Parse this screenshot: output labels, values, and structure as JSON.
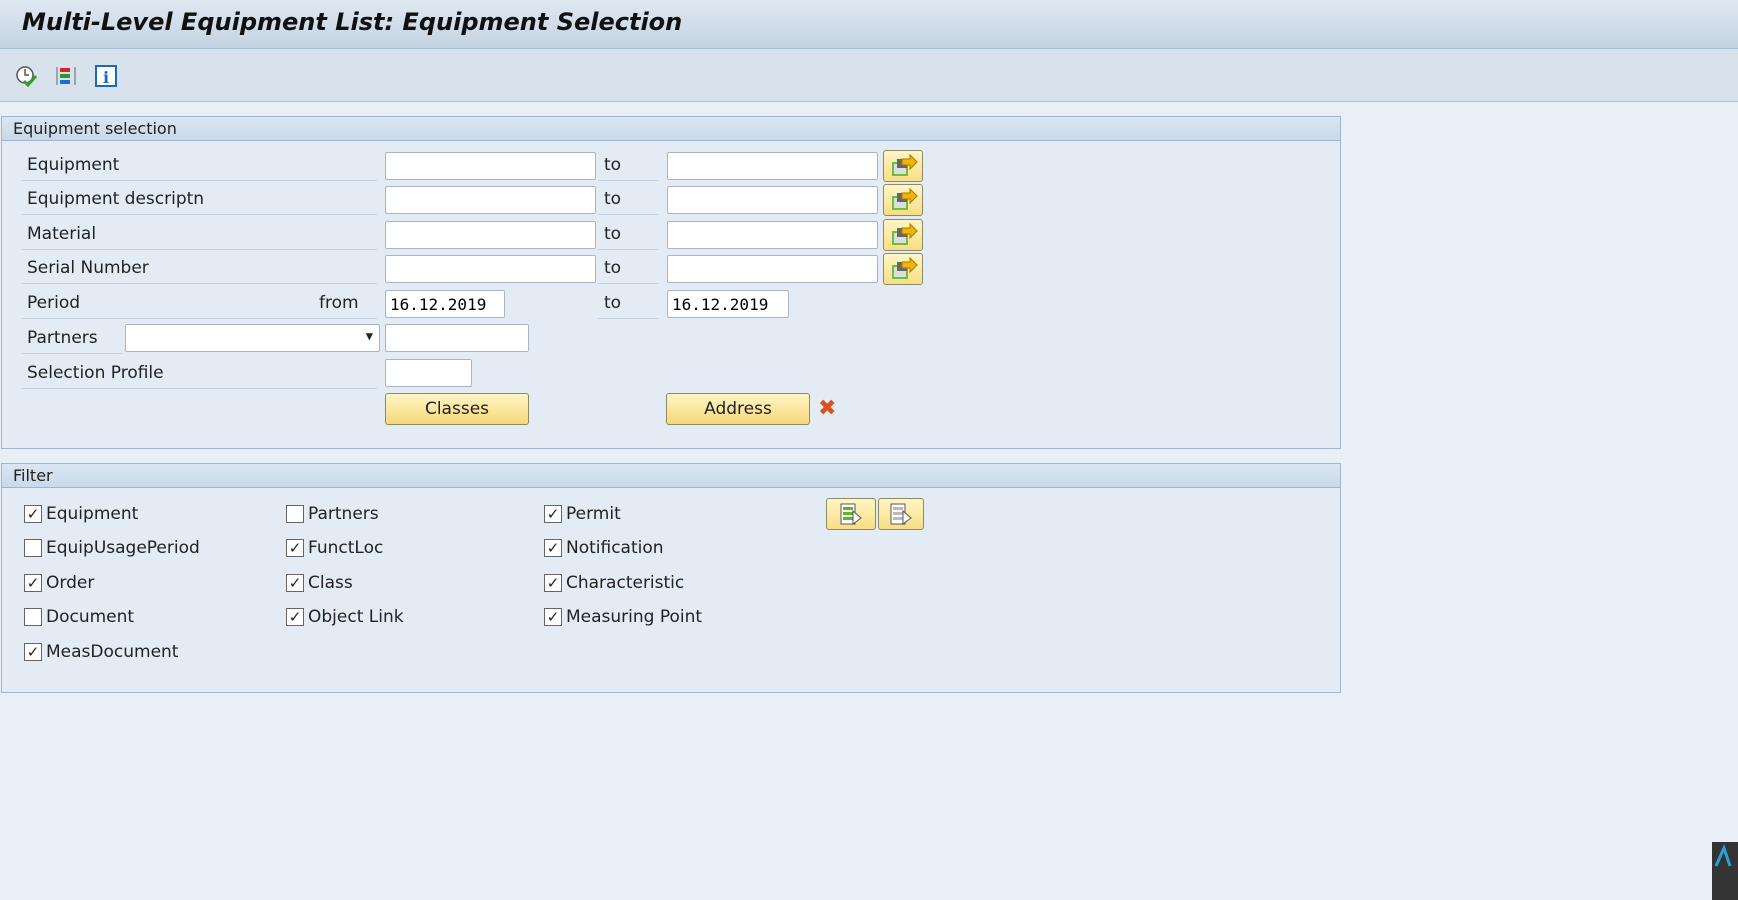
{
  "title": "Multi-Level Equipment List: Equipment Selection",
  "toolbar": {
    "icons": [
      "execute-icon",
      "selection-options-icon",
      "info-icon"
    ]
  },
  "selection": {
    "header": "Equipment selection",
    "to_label": "to",
    "from_label": "from",
    "rows": [
      {
        "label": "Equipment",
        "from": "",
        "to": ""
      },
      {
        "label": "Equipment descriptn",
        "from": "",
        "to": ""
      },
      {
        "label": "Material",
        "from": "",
        "to": ""
      },
      {
        "label": "Serial Number",
        "from": "",
        "to": ""
      }
    ],
    "period": {
      "label": "Period",
      "from": "16.12.2019",
      "to": "16.12.2019"
    },
    "partners": {
      "label": "Partners",
      "role": "",
      "value": ""
    },
    "profile": {
      "label": "Selection Profile",
      "value": ""
    },
    "classes_button": "Classes",
    "address_button": "Address"
  },
  "filter": {
    "header": "Filter",
    "items": [
      {
        "label": "Equipment",
        "checked": true
      },
      {
        "label": "EquipUsagePeriod",
        "checked": false
      },
      {
        "label": "Order",
        "checked": true
      },
      {
        "label": "Document",
        "checked": false
      },
      {
        "label": "MeasDocument",
        "checked": true
      },
      {
        "label": "Partners",
        "checked": false
      },
      {
        "label": "FunctLoc",
        "checked": true
      },
      {
        "label": "Class",
        "checked": true
      },
      {
        "label": "Object Link",
        "checked": true
      },
      {
        "label": "Permit",
        "checked": true
      },
      {
        "label": "Notification",
        "checked": true
      },
      {
        "label": "Characteristic",
        "checked": true
      },
      {
        "label": "Measuring Point",
        "checked": true
      }
    ]
  },
  "colors": {
    "button": "#f8de84",
    "panel": "#e3ecf5",
    "accent_icon": "#f0a800"
  }
}
